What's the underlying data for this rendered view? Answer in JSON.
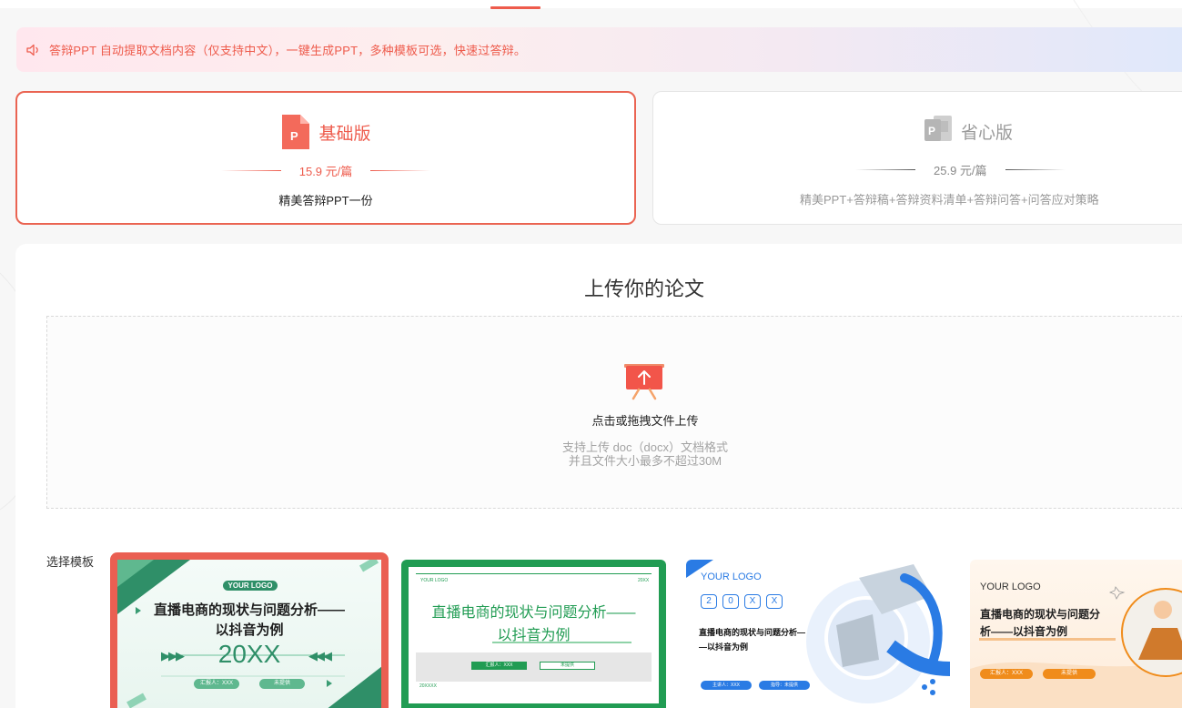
{
  "notice": {
    "icon": "speaker-icon",
    "text": "答辩PPT 自动提取文档内容（仅支持中文），一键生成PPT，多种模板可选，快速过答辩。"
  },
  "plans": {
    "basic": {
      "title": "基础版",
      "price": "15.9 元/篇",
      "desc": "精美答辩PPT一份",
      "icon": "ppt-icon",
      "selected": true
    },
    "pro": {
      "title": "省心版",
      "price": "25.9 元/篇",
      "desc": "精美PPT+答辩稿+答辩资料清单+答辩问答+问答应对策略",
      "icon": "ppt-grey-icon",
      "selected": false
    }
  },
  "upload": {
    "title": "上传你的论文",
    "main": "点击或拖拽文件上传",
    "sub1": "支持上传 doc（docx）文档格式",
    "sub2": "并且文件大小最多不超过30M",
    "icon": "upload-board-icon"
  },
  "templates": {
    "label": "选择模板",
    "items": [
      {
        "logo": "YOUR LOGO",
        "title1": "直播电商的现状与问题分析——",
        "title2": "以抖音为例",
        "year": "20XX",
        "tag1": "汇报人：XXX",
        "tag2": "未提供",
        "selected": true
      },
      {
        "logo": "YOUR LOGO",
        "corner": "20XX",
        "title1": "直播电商的现状与问题分析——",
        "title2": "以抖音为例",
        "tag1": "汇报人：XXX",
        "tag2": "未提供",
        "footer": "20XXXX"
      },
      {
        "logo": "YOUR LOGO",
        "hex": [
          "2",
          "0",
          "X",
          "X"
        ],
        "title1": "直播电商的现状与问题分析—",
        "title2": "—以抖音为例",
        "tag1": "主讲人：XXX",
        "tag2": "指导：未提供"
      },
      {
        "logo": "YOUR LOGO",
        "title1": "直播电商的现状与问题分",
        "title2": "析——以抖音为例",
        "tag1": "汇报人：XXX",
        "tag2": "未提供"
      }
    ]
  },
  "colors": {
    "accent": "#ee5b4c",
    "green": "#219c53",
    "blue": "#2a7be4",
    "orange": "#f08c1b"
  }
}
